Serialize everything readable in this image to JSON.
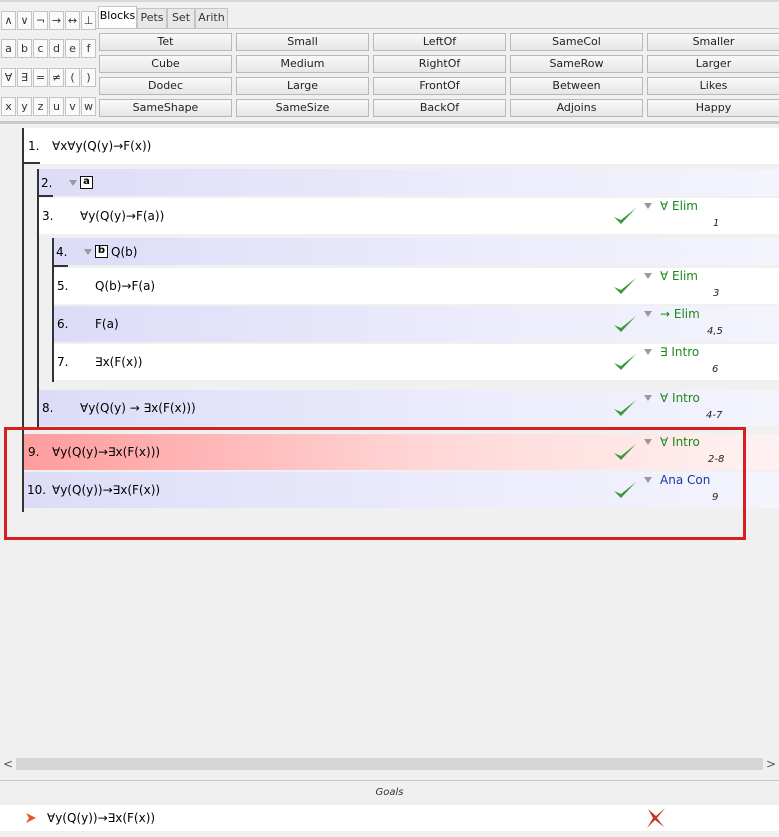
{
  "toolbar": {
    "symbols": [
      [
        "∧",
        "∨",
        "¬",
        "→",
        "↔",
        "⊥"
      ],
      [
        "a",
        "b",
        "c",
        "d",
        "e",
        "f"
      ],
      [
        "∀",
        "∃",
        "=",
        "≠",
        "(",
        ")"
      ],
      [
        "x",
        "y",
        "z",
        "u",
        "v",
        "w"
      ]
    ],
    "tabs": [
      "Blocks",
      "Pets",
      "Set",
      "Arith"
    ],
    "active_tab": "Blocks",
    "predicates": [
      [
        "Tet",
        "Small",
        "LeftOf",
        "SameCol",
        "Smaller"
      ],
      [
        "Cube",
        "Medium",
        "RightOf",
        "SameRow",
        "Larger"
      ],
      [
        "Dodec",
        "Large",
        "FrontOf",
        "Between",
        "Likes"
      ],
      [
        "SameShape",
        "SameSize",
        "BackOf",
        "Adjoins",
        "Happy"
      ]
    ]
  },
  "proof": {
    "lines": [
      {
        "num": "1.",
        "sentence": "∀x∀y(Q(y)→F(x))"
      },
      {
        "num": "2.",
        "box_constant": "a"
      },
      {
        "num": "3.",
        "sentence": "∀y(Q(y)→F(a))",
        "rule": "∀ Elim",
        "support": "1"
      },
      {
        "num": "4.",
        "box_constant": "b",
        "sentence": "Q(b)"
      },
      {
        "num": "5.",
        "sentence": "Q(b)→F(a)",
        "rule": "∀ Elim",
        "support": "3"
      },
      {
        "num": "6.",
        "sentence": "F(a)",
        "rule": "→ Elim",
        "support": "4,5"
      },
      {
        "num": "7.",
        "sentence": "∃x(F(x))",
        "rule": "∃ Intro",
        "support": "6"
      },
      {
        "num": "8.",
        "sentence": "∀y(Q(y) → ∃x(F(x)))",
        "rule": "∀ Intro",
        "support": "4-7"
      },
      {
        "num": "9.",
        "sentence": "∀y(Q(y)→∃x(F(x)))",
        "rule": "∀ Intro",
        "support": "2-8"
      },
      {
        "num": "10.",
        "sentence": "∀y(Q(y))→∃x(F(x))",
        "rule": "Ana Con",
        "support": "9"
      }
    ]
  },
  "scrollbar": {
    "left_arrow": "<",
    "right_arrow": ">"
  },
  "goals": {
    "title": "Goals",
    "items": [
      {
        "sentence": "∀y(Q(y))→∃x(F(x))",
        "status": "unsatisfied"
      }
    ]
  },
  "colors": {
    "highlight_border": "#d42020",
    "check": "#3a9a3a",
    "rule_text": "#1a8a1a",
    "ana_con_text": "#1a3a9a",
    "goal_x": "#c0392b",
    "goal_arrow": "#e8542c"
  },
  "icons": {
    "check": "checkmark-icon",
    "rule_menu": "triangle-down-icon",
    "goal_pointer": "arrow-pointer-icon",
    "goal_status": "x-cross-icon"
  }
}
